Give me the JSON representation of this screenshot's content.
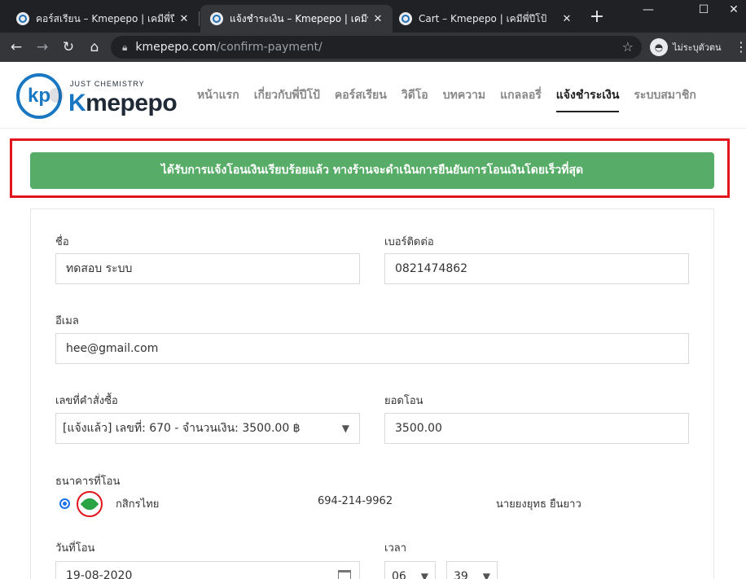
{
  "browser": {
    "tabs": [
      {
        "title": "คอร์สเรียน – Kmepepo | เคมีพี่ปีโป้",
        "active": false
      },
      {
        "title": "แจ้งชำระเงิน – Kmepepo | เคมีพี่ปีโป้",
        "active": true
      },
      {
        "title": "Cart – Kmepepo | เคมีพี่ปีโป้",
        "active": false
      }
    ],
    "url_host": "kmepepo.com",
    "url_path": "/confirm-payment/",
    "profile_label": "ไม่ระบุตัวตน"
  },
  "site": {
    "logo_tagline": "JUST CHEMISTRY",
    "logo_brand_k": "K",
    "logo_brand_rest": "mepepo",
    "logo_mark": "kp",
    "nav": [
      {
        "label": "หน้าแรก",
        "active": false
      },
      {
        "label": "เกี่ยวกับพี่ปีโป้",
        "active": false
      },
      {
        "label": "คอร์สเรียน",
        "active": false
      },
      {
        "label": "วิดีโอ",
        "active": false
      },
      {
        "label": "บทความ",
        "active": false
      },
      {
        "label": "แกลลอรี่",
        "active": false
      },
      {
        "label": "แจ้งชำระเงิน",
        "active": true
      },
      {
        "label": "ระบบสมาชิก",
        "active": false
      }
    ]
  },
  "alert": {
    "message": "ได้รับการแจ้งโอนเงินเรียบร้อยแล้ว ทางร้านจะดำเนินการยืนยันการโอนเงินโดยเร็วที่สุด",
    "color": "#57ad68",
    "highlight_color": "#e1151b"
  },
  "form": {
    "name_label": "ชื่อ",
    "name_value": "ทดสอบ ระบบ",
    "phone_label": "เบอร์ติดต่อ",
    "phone_value": "0821474862",
    "email_label": "อีเมล",
    "email_value": "hee@gmail.com",
    "order_label": "เลขที่คำสั่งซื้อ",
    "order_value": "[แจ้งแล้ว] เลขที่: 670 - จำนวนเงิน: 3500.00 ฿",
    "amount_label": "ยอดโอน",
    "amount_value": "3500.00",
    "bank_label": "ธนาคารที่โอน",
    "bank": {
      "name": "กสิกรไทย",
      "account_number": "694-214-9962",
      "account_holder": "นายยงยุทธ ยืนยาว",
      "selected": true
    },
    "date_label": "วันที่โอน",
    "date_value": "19-08-2020",
    "time_label": "เวลา",
    "hour_value": "06",
    "minute_value": "39"
  }
}
